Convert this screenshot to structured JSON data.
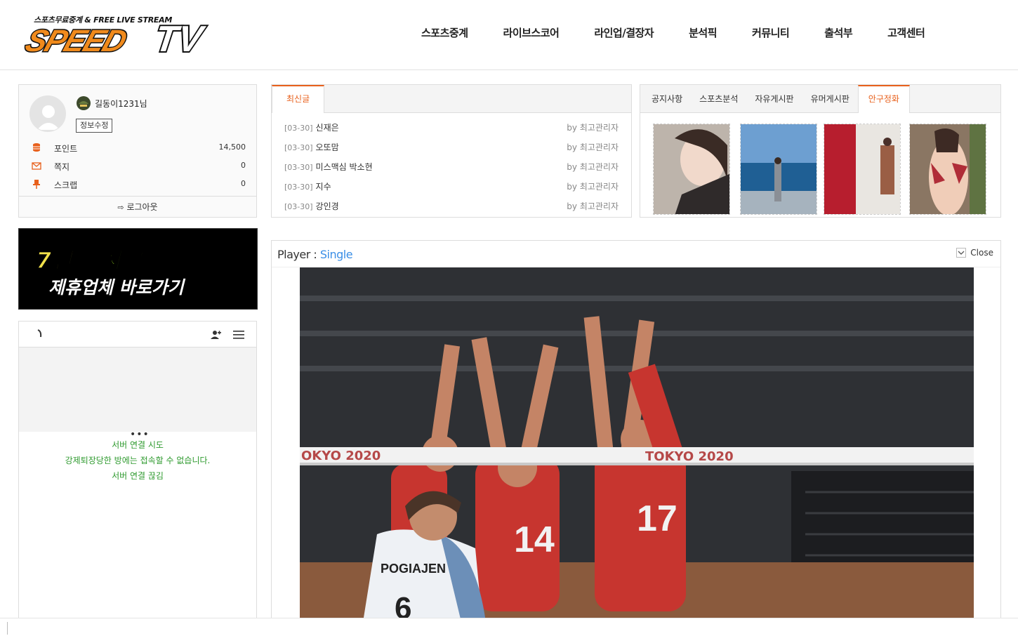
{
  "brand": {
    "tagline": "스포츠무료중계 & FREE LIVE STREAM",
    "name": "SPEEDTV",
    "accent": "#f08a1c"
  },
  "nav": [
    "스포츠중계",
    "라이브스코어",
    "라인업/결장자",
    "분석픽",
    "커뮤니티",
    "출석부",
    "고객센터"
  ],
  "profile": {
    "username": "길동이1231님",
    "edit_label": "정보수정",
    "stats": [
      {
        "icon": "coins-icon",
        "label": "포인트",
        "value": "14,500"
      },
      {
        "icon": "mail-icon",
        "label": "쪽지",
        "value": "0"
      },
      {
        "icon": "pin-icon",
        "label": "스크랩",
        "value": "0"
      }
    ],
    "logout_label": "로그아웃"
  },
  "banner": {
    "line1_a": "7년",
    "line1_b": "무사고",
    "line2": "제휴업체 바로가기"
  },
  "chat": {
    "messages": [
      "서버 연결 시도",
      "강제퇴장당한 방에는 접속할 수 없습니다.",
      "서버 연결 끊김"
    ]
  },
  "latest": {
    "tab": "최신글",
    "posts": [
      {
        "date": "[03-30]",
        "title": "신재은",
        "by": "by 최고관리자"
      },
      {
        "date": "[03-30]",
        "title": "오또맘",
        "by": "by 최고관리자"
      },
      {
        "date": "[03-30]",
        "title": "미스맥심 박소현",
        "by": "by 최고관리자"
      },
      {
        "date": "[03-30]",
        "title": "지수",
        "by": "by 최고관리자"
      },
      {
        "date": "[03-30]",
        "title": "강인경",
        "by": "by 최고관리자"
      }
    ]
  },
  "boards": {
    "tabs": [
      "공지사항",
      "스포츠분석",
      "자유게시판",
      "유머게시판",
      "안구정화"
    ],
    "active_index": 4
  },
  "player": {
    "label": "Player :",
    "mode": "Single",
    "close_label": "Close"
  },
  "video": {
    "banner_text": "TOKYO 2020",
    "banner_text_left": "OKYO 2020",
    "jersey_numbers": [
      "14",
      "17"
    ],
    "player_name": "POGIAJEN",
    "player_number": "6"
  }
}
